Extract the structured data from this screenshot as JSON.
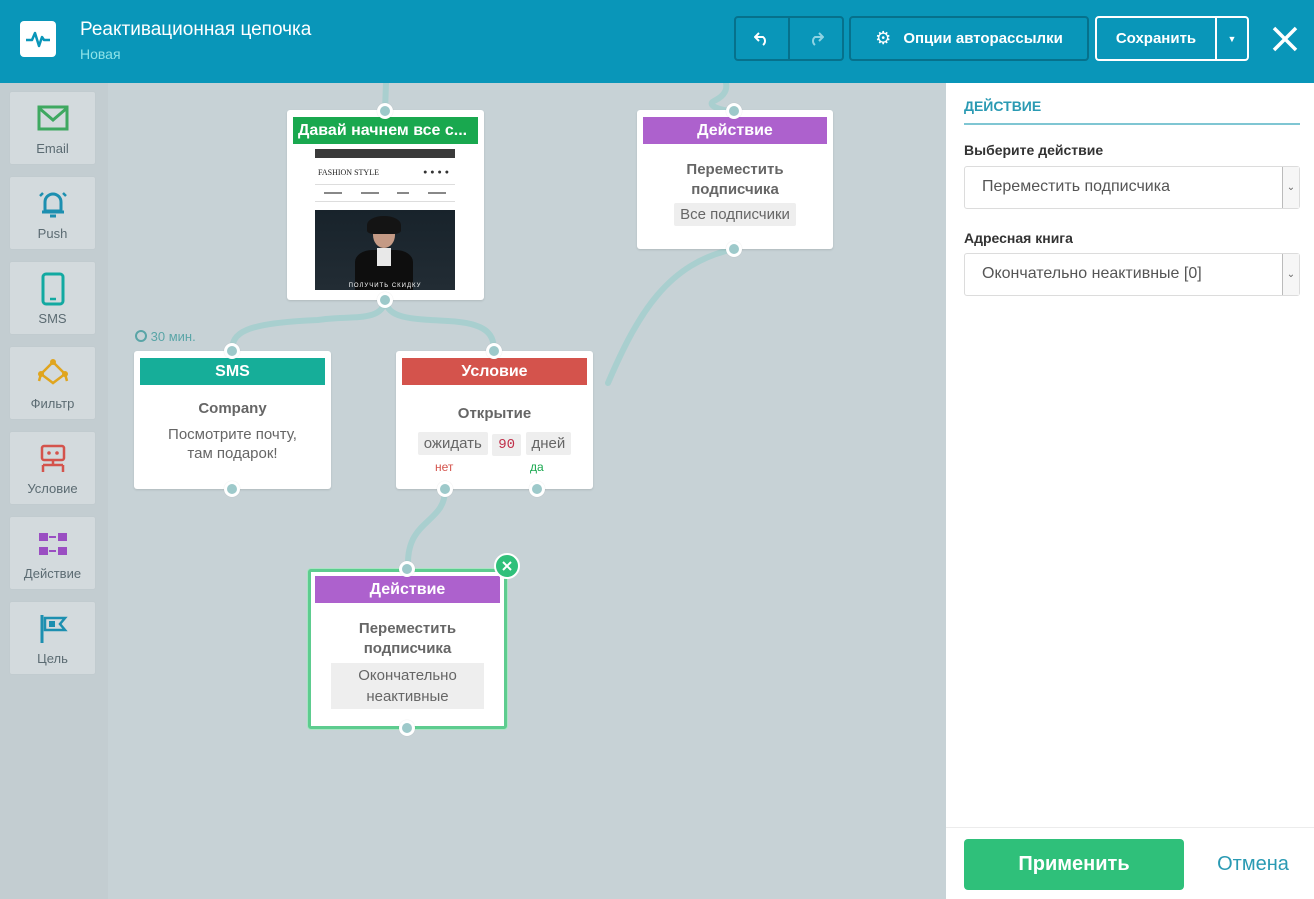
{
  "header": {
    "title": "Реактивационная цепочка",
    "status": "Новая",
    "options_label": "Опции авторассылки",
    "save_label": "Сохранить",
    "icons": [
      "undo-icon",
      "redo-icon",
      "gear-icon",
      "chevron-down-icon",
      "close-icon"
    ]
  },
  "sidebar": {
    "items": [
      {
        "label": "Email",
        "icon": "envelope-icon",
        "color": "#3ea860"
      },
      {
        "label": "Push",
        "icon": "bell-icon",
        "color": "#1c8fb0"
      },
      {
        "label": "SMS",
        "icon": "phone-icon",
        "color": "#12a9a1"
      },
      {
        "label": "Фильтр",
        "icon": "filter-icon",
        "color": "#e0a51e"
      },
      {
        "label": "Условие",
        "icon": "condition-icon",
        "color": "#d4534c"
      },
      {
        "label": "Действие",
        "icon": "action-icon",
        "color": "#9a4ec2"
      },
      {
        "label": "Цель",
        "icon": "goal-flag-icon",
        "color": "#1c8fb0"
      }
    ]
  },
  "canvas": {
    "email_node": {
      "header": "Давай начнем все с...",
      "header_color": "#19a84f",
      "preview_brand": "FASHION STYLE",
      "preview_cta": "ПОЛУЧИТЬ СКИДКУ"
    },
    "action_top": {
      "header": "Действие",
      "title": "Переместить подписчика",
      "chip": "Все подписчики",
      "header_color": "#ad61cd"
    },
    "sms_node": {
      "delay": "30 мин.",
      "header": "SMS",
      "title": "Company",
      "text": "Посмотрите почту, там подарок!",
      "header_color": "#16ae99"
    },
    "condition_node": {
      "header": "Условие",
      "title": "Открытие",
      "wait": "ожидать",
      "days_value": "90",
      "days": "дней",
      "no_label": "нет",
      "yes_label": "да",
      "header_color": "#d4534c"
    },
    "action_bottom": {
      "header": "Действие",
      "title": "Переместить подписчика",
      "chip": "Окончательно неактивные",
      "header_color": "#ad61cd"
    }
  },
  "panel": {
    "section_title": "ДЕЙСТВИЕ",
    "action_label": "Выберите действие",
    "action_value": "Переместить подписчика",
    "book_label": "Адресная книга",
    "book_value": "Окончательно неактивные [0]",
    "apply_label": "Применить",
    "cancel_label": "Отмена",
    "accent_color": "#2fc07a"
  }
}
